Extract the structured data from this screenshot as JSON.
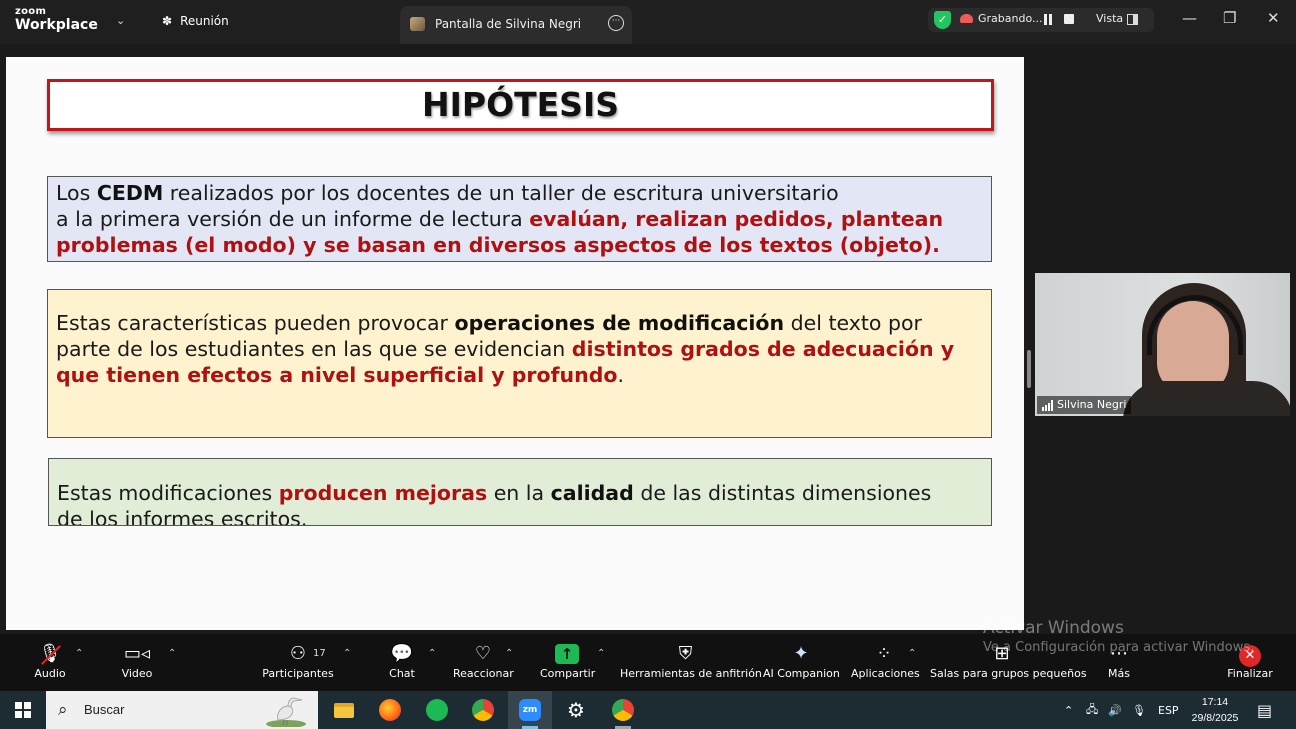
{
  "zoom": {
    "logo_top": "zoom",
    "logo_bottom": "Workplace",
    "meeting_label": "Reunión",
    "share_tab_label": "Pantalla de Silvina Negri",
    "recording_label": "Grabando...",
    "view_label": "Vista"
  },
  "slide": {
    "title": "HIPÓTESIS",
    "box1": {
      "l1_a": "Los ",
      "l1_b": "CEDM",
      "l1_c": " realizados por los docentes de un taller de escritura universitario",
      "l2_a": "a la primera versión de un informe de lectura ",
      "l2_b": "evalúan, realizan pedidos, plantean",
      "l3": "problemas (el modo) y se basan en diversos aspectos de los textos (objeto)."
    },
    "box2": {
      "l1_a": "Estas características pueden provocar ",
      "l1_b": "operaciones de modificación",
      "l1_c": " del texto por",
      "l2_a": "parte de los estudiantes en las que se evidencian ",
      "l2_b": "distintos grados de adecuación y",
      "l3_a": "que tienen efectos a nivel superficial y profundo",
      "l3_b": "."
    },
    "box3": {
      "l1_a": "Estas modificaciones ",
      "l1_b": "producen mejoras",
      "l1_c": " en la ",
      "l1_d": "calidad",
      "l1_e": " de las distintas dimensiones",
      "l2": "de los informes escritos."
    }
  },
  "participant": {
    "name": "Silvina Negri"
  },
  "toolbar": {
    "audio": "Audio",
    "video": "Video",
    "participants": "Participantes",
    "participants_count": "17",
    "chat": "Chat",
    "react": "Reaccionar",
    "share": "Compartir",
    "host_tools": "Herramientas de anfitrión",
    "ai": "AI Companion",
    "apps": "Aplicaciones",
    "breakout": "Salas para grupos pequeños",
    "more": "Más",
    "end": "Finalizar"
  },
  "watermark": {
    "line1": "Activar Windows",
    "line2": "Ve a Configuración para activar Windows."
  },
  "taskbar": {
    "search_placeholder": "Buscar",
    "lang": "ESP",
    "time": "17:14",
    "date": "29/8/2025"
  },
  "colors": {
    "title_border": "#c0151a",
    "emphasis_red": "#b01010",
    "box1_bg": "#e3e6f4",
    "box2_bg": "#fef2cf",
    "box3_bg": "#e2edd7",
    "zoom_share_green": "#1db954",
    "zoom_end_red": "#e02828"
  }
}
